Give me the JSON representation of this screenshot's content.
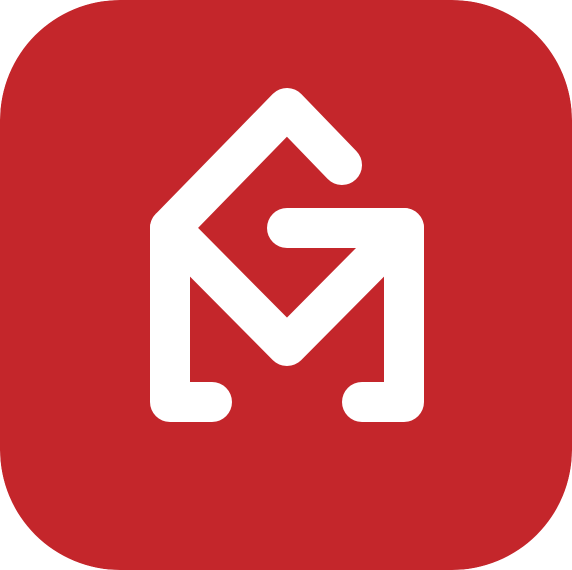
{
  "icon": {
    "name": "gm-house-logo-icon",
    "colors": {
      "background": "#C4262B",
      "glyph": "#FFFFFF"
    }
  }
}
